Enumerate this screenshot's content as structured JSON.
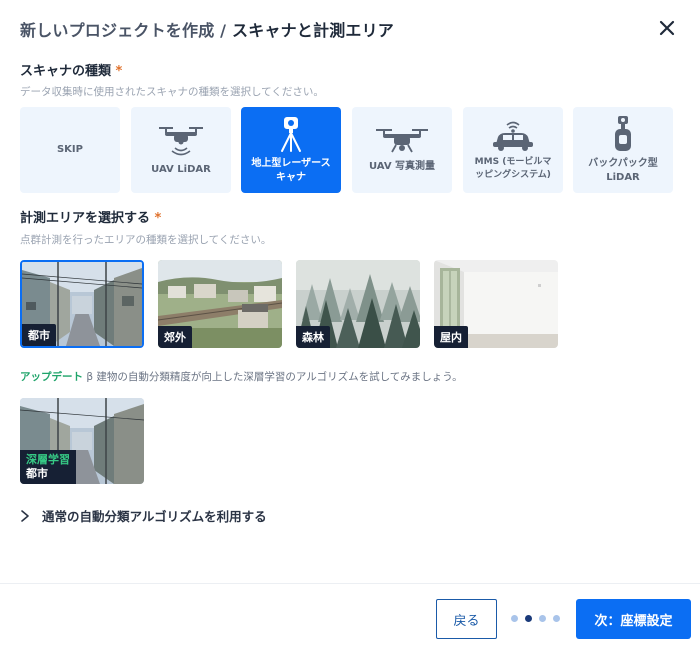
{
  "header": {
    "breadcrumb": "新しいプロジェクトを作成 /",
    "title": "スキャナと計測エリア"
  },
  "scanner_section": {
    "label": "スキャナの種類",
    "required_mark": "*",
    "help": "データ収集時に使用されたスキャナの種類を選択してください。",
    "options": [
      {
        "label": "SKIP",
        "icon": "none",
        "selected": false
      },
      {
        "label": "UAV LiDAR",
        "icon": "drone-lidar-icon",
        "selected": false
      },
      {
        "label": "地上型レーザースキャナ",
        "icon": "tripod-scanner-icon",
        "selected": true
      },
      {
        "label": "UAV 写真測量",
        "icon": "drone-camera-icon",
        "selected": false
      },
      {
        "label": "MMS (モービルマッピングシステム)",
        "icon": "vehicle-scanner-icon",
        "selected": false
      },
      {
        "label": "バックパック型LiDAR",
        "icon": "backpack-lidar-icon",
        "selected": false
      }
    ]
  },
  "area_section": {
    "label": "計測エリアを選択する",
    "required_mark": "*",
    "help": "点群計測を行ったエリアの種類を選択してください。",
    "options": [
      {
        "label": "都市",
        "selected": true
      },
      {
        "label": "郊外",
        "selected": false
      },
      {
        "label": "森林",
        "selected": false
      },
      {
        "label": "屋内",
        "selected": false
      }
    ]
  },
  "update": {
    "badge": "アップデート",
    "text": "β 建物の自動分類精度が向上した深層学習のアルゴリズムを試してみましょう。",
    "card_top": "深層学習",
    "card_bottom": "都市"
  },
  "expander": {
    "label": "通常の自動分類アルゴリズムを利用する"
  },
  "footer": {
    "back_label": "戻る",
    "next_label": "次：座標設定",
    "steps_total": 4,
    "current_step": 2
  },
  "colors": {
    "accent": "#0b6ef3",
    "required": "#e0722d",
    "update_green": "#1fa46a",
    "tag_bg": "#162034"
  }
}
